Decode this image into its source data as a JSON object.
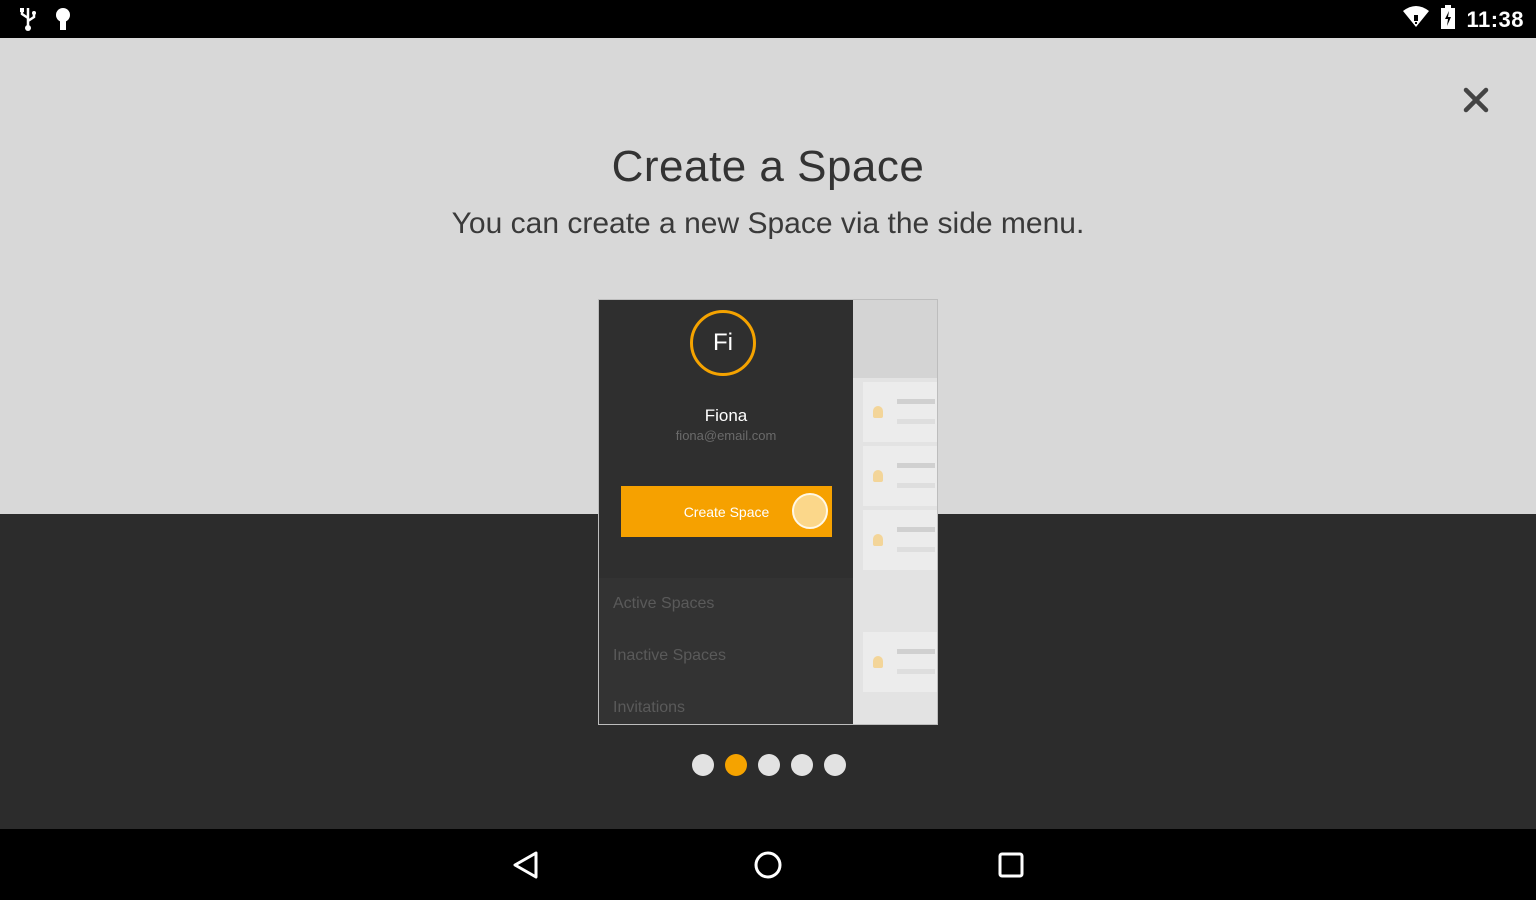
{
  "status_bar": {
    "left_icons": [
      "usb-icon",
      "debug-icon"
    ],
    "right_icons": [
      "wifi-icon",
      "battery-icon"
    ],
    "time": "11:38"
  },
  "onboarding": {
    "close_icon": "close-icon",
    "title": "Create a Space",
    "subtitle": "You can create a new Space via the side menu.",
    "accent_color": "#f5a300"
  },
  "mockup": {
    "avatar_initials": "Fi",
    "user_name": "Fiona",
    "user_email": "fiona@email.com",
    "create_button_label": "Create Space",
    "menu_items": [
      "Active Spaces",
      "Inactive Spaces",
      "Invitations"
    ]
  },
  "pager": {
    "total_pages": 5,
    "current_page": 2
  },
  "nav_bar": {
    "buttons": [
      "back-icon",
      "home-icon",
      "recents-icon"
    ]
  }
}
